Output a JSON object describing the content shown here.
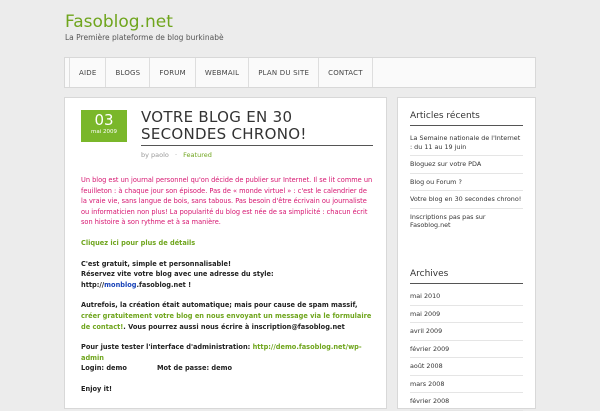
{
  "site": {
    "title": "Fasoblog.net",
    "tagline": "La Première plateforme de blog burkinabè"
  },
  "nav": {
    "items": [
      "AIDE",
      "BLOGS",
      "FORUM",
      "WEBMAIL",
      "PLAN DU SITE",
      "CONTACT"
    ]
  },
  "post": {
    "date_day": "03",
    "date_month": "mai 2009",
    "title": "VOTRE BLOG EN 30 SECONDES CHRONO!",
    "meta_by": "by paolo",
    "meta_sep": "·",
    "meta_category": "Featured",
    "intro": "Un blog est un journal personnel qu'on décide de publier sur Internet. Il se lit comme un feuilleton : à chaque jour son épisode. Pas de « monde virtuel » : c'est le calendrier de la vraie vie, sans langue de bois, sans tabous. Pas besoin d'être écrivain ou journaliste ou informaticien non plus! La popularité du blog est née de sa simplicité : chacun écrit son histoire à son rythme et à sa manière.",
    "details_link": "Cliquez ici pour plus de détails",
    "free_line": "C'est gratuit, simple et personnalisable!",
    "reserve_text": "Réservez vite votre blog avec une adresse du style: http://",
    "reserve_highlight": "monblog",
    "reserve_suffix": ".fasoblog.net !",
    "auto_text": "Autrefois, la création était automatique; mais pour cause de spam massif, ",
    "auto_link": "créer gratuitement votre blog en nous envoyant un message via le formulaire de contact!",
    "auto_suffix": ". Vous pourrez aussi nous écrire à inscription@fasoblog.net",
    "test_text": "Pour juste tester l'interface d'administration: ",
    "test_link": "http://demo.fasoblog.net/wp-admin",
    "login_label": "Login: demo",
    "password_label": "Mot de passe: demo",
    "enjoy": "Enjoy it!"
  },
  "sidebar": {
    "recent_title": "Articles récents",
    "recent": [
      "La Semaine nationale de l'Internet : du 11 au 19 juin",
      "Bloguez sur votre PDA",
      "Blog ou Forum ?",
      "Votre blog en 30 secondes chrono!",
      "Inscriptions pas pas sur Fasoblog.net"
    ],
    "archives_title": "Archives",
    "archives": [
      "mai 2010",
      "mai 2009",
      "avril 2009",
      "février 2009",
      "août 2008",
      "mars 2008",
      "février 2008"
    ]
  }
}
